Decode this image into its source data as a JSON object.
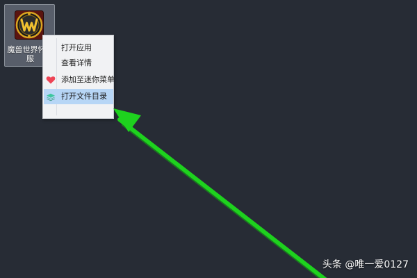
{
  "desktop": {
    "background": "#272c35",
    "shortcut": {
      "label": "魔兽世界怀旧服",
      "icon": "wow-logo-icon"
    }
  },
  "context_menu": {
    "items": [
      {
        "label": "打开应用",
        "icon": "",
        "highlighted": false
      },
      {
        "label": "查看详情",
        "icon": "",
        "highlighted": false
      },
      {
        "label": "添加至迷你菜单",
        "icon": "heart-icon",
        "highlighted": false
      },
      {
        "label": "打开文件目录",
        "icon": "layers-icon",
        "highlighted": true
      }
    ],
    "highlight_color": "#b7d6f6"
  },
  "annotation": {
    "arrow_color": "#1ed21e"
  },
  "watermark": {
    "text": "头条 @唯一爱0127"
  }
}
